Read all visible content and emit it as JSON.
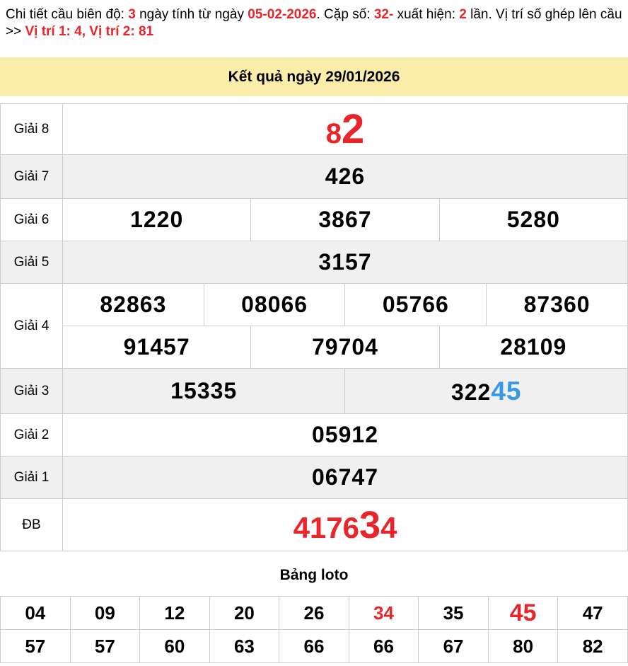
{
  "colors": {
    "red": "#e8252b",
    "blue": "#3598ea",
    "banner_bg": "#faedaa",
    "alt_row_bg": "#f0f0f0",
    "border": "#cccccc"
  },
  "header": {
    "parts": [
      {
        "text": "Chi tiết cầu biên độ: "
      },
      {
        "text": "3"
      },
      {
        "text": " ngày tính từ ngày "
      },
      {
        "text": "05-02-2026"
      },
      {
        "text": ". Cặp số: "
      },
      {
        "text": "32-"
      },
      {
        "text": " xuất hiện: "
      },
      {
        "text": "2"
      },
      {
        "text": " lần. Vị trí số ghép lên cầu >> "
      },
      {
        "text": "Vị trí 1: 4, Vị trí 2: 81"
      }
    ]
  },
  "banner": {
    "title": "Kết quả ngày 29/01/2026"
  },
  "results": {
    "g8": {
      "label": "Giải 8",
      "small": "8",
      "big": "2"
    },
    "g7": {
      "label": "Giải 7",
      "value": "426"
    },
    "g6": {
      "label": "Giải 6",
      "values": [
        "1220",
        "3867",
        "5280"
      ]
    },
    "g5": {
      "label": "Giải 5",
      "value": "3157"
    },
    "g4": {
      "label": "Giải 4",
      "row1": [
        "82863",
        "08066",
        "05766",
        "87360"
      ],
      "row2": [
        "91457",
        "79704",
        "28109"
      ]
    },
    "g3": {
      "label": "Giải 3",
      "left": "15335",
      "right_black": "322",
      "right_blue": "45"
    },
    "g2": {
      "label": "Giải 2",
      "value": "05912"
    },
    "g1": {
      "label": "Giải 1",
      "value": "06747"
    },
    "db": {
      "label": "ĐB",
      "part1": "4176",
      "big": "3",
      "part2": "4"
    }
  },
  "loto": {
    "title": "Bảng loto",
    "row1": [
      {
        "v": "04",
        "cls": ""
      },
      {
        "v": "09",
        "cls": ""
      },
      {
        "v": "12",
        "cls": ""
      },
      {
        "v": "20",
        "cls": ""
      },
      {
        "v": "26",
        "cls": ""
      },
      {
        "v": "34",
        "cls": "red"
      },
      {
        "v": "35",
        "cls": ""
      },
      {
        "v": "45",
        "cls": "red lg"
      },
      {
        "v": "47",
        "cls": ""
      }
    ],
    "row2": [
      {
        "v": "57",
        "cls": ""
      },
      {
        "v": "57",
        "cls": ""
      },
      {
        "v": "60",
        "cls": ""
      },
      {
        "v": "63",
        "cls": ""
      },
      {
        "v": "66",
        "cls": ""
      },
      {
        "v": "66",
        "cls": ""
      },
      {
        "v": "67",
        "cls": ""
      },
      {
        "v": "80",
        "cls": ""
      },
      {
        "v": "82",
        "cls": ""
      }
    ]
  }
}
